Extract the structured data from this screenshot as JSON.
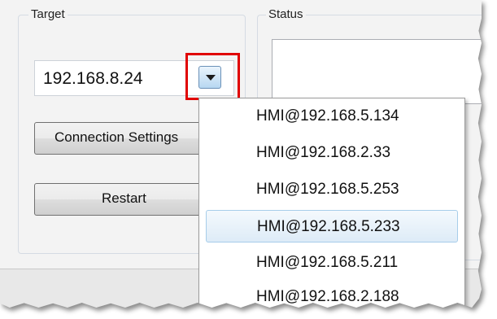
{
  "target": {
    "title": "Target",
    "selected_value": "192.168.8.24",
    "connection_settings_label": "Connection Settings",
    "restart_label": "Restart"
  },
  "status": {
    "title": "Status"
  },
  "dropdown": {
    "options": [
      "HMI@192.168.5.134",
      "HMI@192.168.2.33",
      "HMI@192.168.5.253",
      "HMI@192.168.5.233",
      "HMI@192.168.5.211",
      "HMI@192.168.2.188"
    ],
    "highlighted_option": "HMI@192.168.5.233"
  },
  "colors": {
    "highlight_box": "#e00000",
    "selected_item": "#ddebf7"
  },
  "icons": {
    "dropdown_button": "chevron-down-icon"
  }
}
